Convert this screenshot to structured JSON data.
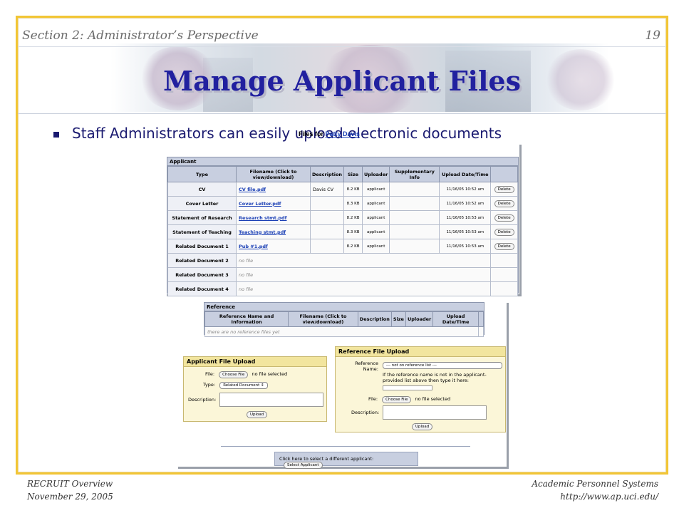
{
  "slide": {
    "section_label": "Section 2: Administrator’s Perspective",
    "page_number": "19",
    "title": "Manage Applicant Files",
    "bullet": "Staff Administrators can easily upload electronic documents"
  },
  "files_panel": {
    "title_prefix": "Files for",
    "applicant_name": "Patty Davis",
    "section_label": "Applicant",
    "columns": [
      "Type",
      "Filename (Click to view/download)",
      "Description",
      "Size",
      "Uploader",
      "Supplementary Info",
      "Upload Date/Time",
      ""
    ],
    "rows": [
      {
        "type": "CV",
        "filename": "CV file.pdf",
        "description": "Davis CV",
        "size": "8.2 KB",
        "uploader": "applicant",
        "info": "",
        "datetime": "11/16/05 10:52 am",
        "action": "Delete"
      },
      {
        "type": "Cover Letter",
        "filename": "Cover Letter.pdf",
        "description": "",
        "size": "8.3 KB",
        "uploader": "applicant",
        "info": "",
        "datetime": "11/16/05 10:52 am",
        "action": "Delete"
      },
      {
        "type": "Statement of Research",
        "filename": "Research stmt.pdf",
        "description": "",
        "size": "8.2 KB",
        "uploader": "applicant",
        "info": "",
        "datetime": "11/16/05 10:53 am",
        "action": "Delete"
      },
      {
        "type": "Statement of Teaching",
        "filename": "Teaching stmt.pdf",
        "description": "",
        "size": "8.3 KB",
        "uploader": "applicant",
        "info": "",
        "datetime": "11/16/05 10:53 am",
        "action": "Delete"
      },
      {
        "type": "Related Document 1",
        "filename": "Pub #1.pdf",
        "description": "",
        "size": "8.2 KB",
        "uploader": "applicant",
        "info": "",
        "datetime": "11/16/05 10:53 am",
        "action": "Delete"
      },
      {
        "type": "Related Document 2",
        "filename": "no file"
      },
      {
        "type": "Related Document 3",
        "filename": "no file"
      },
      {
        "type": "Related Document 4",
        "filename": "no file"
      }
    ]
  },
  "reference_panel": {
    "section_label": "Reference",
    "columns": [
      "Reference Name and Information",
      "Filename (Click to view/download)",
      "Description",
      "Size",
      "Uploader",
      "Upload Date/Time",
      ""
    ],
    "empty_message": "there are no reference files yet"
  },
  "applicant_upload": {
    "title": "Applicant File Upload",
    "file_label": "File:",
    "choose_file": "Choose File",
    "no_file": "no file selected",
    "type_label": "Type:",
    "type_value": "Related Document",
    "description_label": "Description:",
    "upload_button": "Upload"
  },
  "reference_upload": {
    "title": "Reference File Upload",
    "reference_label": "Reference Name:",
    "reference_select": "--- not on reference list ---",
    "hint": "If the reference name is not in the applicant-provided list above then type it here:",
    "file_label": "File:",
    "choose_file": "Choose File",
    "no_file": "no file selected",
    "description_label": "Description:",
    "upload_button": "Upload"
  },
  "select_applicant": {
    "text": "Click here to select a different applicant:",
    "button": "Select Applicant"
  },
  "footer": {
    "left_line1": "RECRUIT Overview",
    "left_line2": "November 29, 2005",
    "right_line1": "Academic Personnel Systems",
    "right_line2": "http://www.ap.uci.edu/"
  },
  "colors": {
    "frame": "#f2c535",
    "title": "#21209f",
    "link": "#1a3fb5",
    "table_header": "#c8cfe0",
    "upload_panel": "#fbf6d8"
  }
}
